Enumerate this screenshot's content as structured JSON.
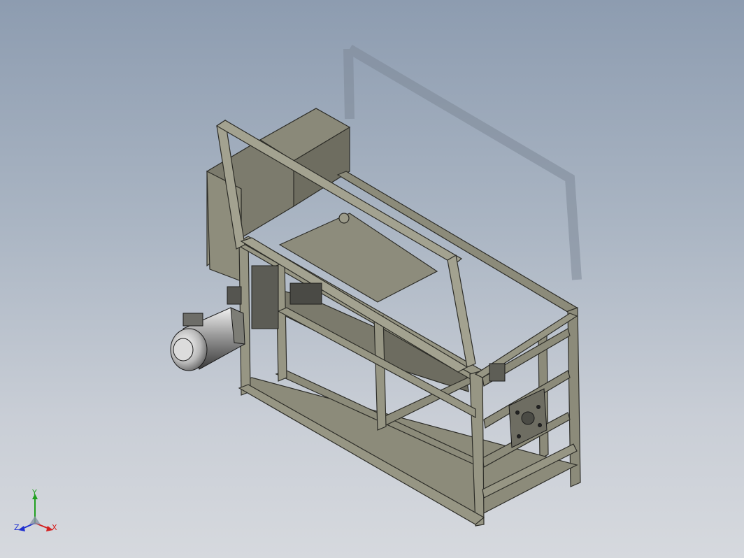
{
  "viewport": {
    "background_top": "#8d9cb0",
    "background_bottom": "#d6d9de",
    "model_color": "#8c8b7a",
    "edge_color": "#2d2d28"
  },
  "triad": {
    "x_label": "X",
    "y_label": "Y",
    "z_label": "Z",
    "x_color": "#d42020",
    "y_color": "#20a020",
    "z_color": "#2030d0"
  }
}
